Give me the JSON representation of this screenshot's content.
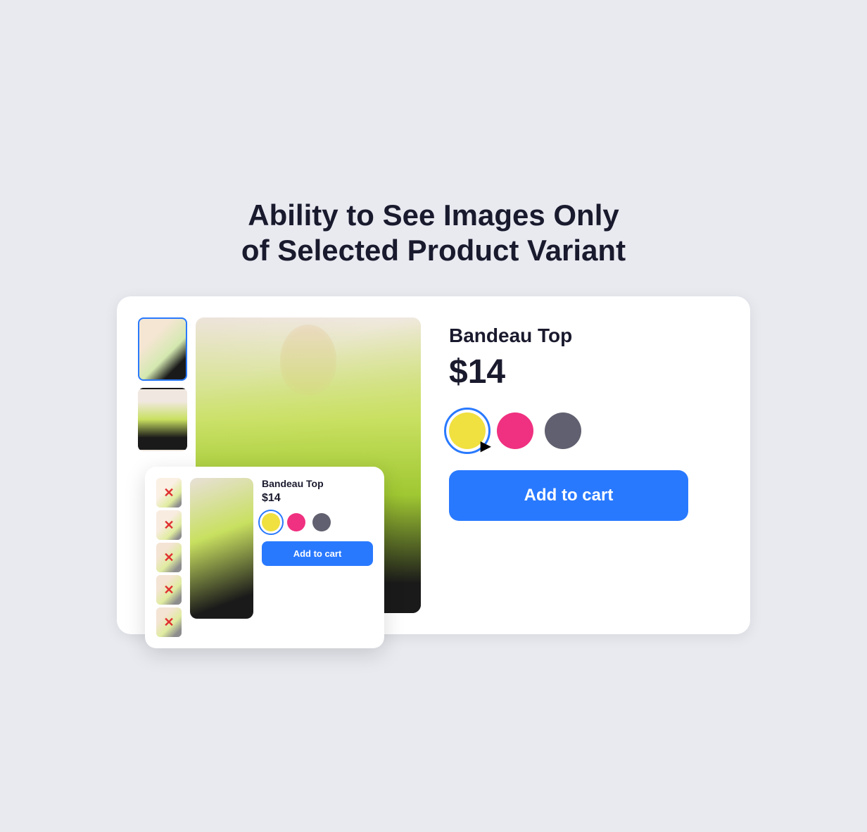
{
  "page": {
    "title_line1": "Ability to See Images Only",
    "title_line2": "of Selected Product Variant",
    "background_color": "#e8eaf0"
  },
  "product": {
    "name": "Bandeau Top",
    "price": "$14",
    "colors": [
      {
        "id": "yellow",
        "label": "Yellow",
        "hex": "#f0e040",
        "selected": true
      },
      {
        "id": "pink",
        "label": "Pink",
        "hex": "#f03080",
        "selected": false
      },
      {
        "id": "gray",
        "label": "Gray",
        "hex": "#606070",
        "selected": false
      }
    ],
    "add_to_cart_label": "Add to cart"
  },
  "mini_card": {
    "product_name": "Bandeau Top",
    "product_price": "$14",
    "add_to_cart_label": "Add to cart",
    "thumbnails_crossed": [
      true,
      true,
      true,
      true,
      true
    ]
  },
  "icons": {
    "cursor": "➤",
    "cross": "✕"
  }
}
